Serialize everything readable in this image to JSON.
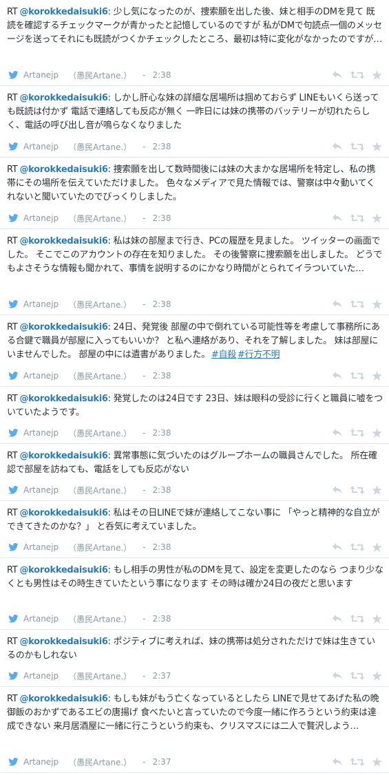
{
  "colors": {
    "link": "#2b7bb9",
    "meta": "#8899a6",
    "text": "#292f33",
    "divider": "#e1e8ed",
    "icon": "#ccd6dd"
  },
  "tweets": [
    {
      "rt": "RT",
      "author": "@korokkedaisuki6",
      "text": ": 少し気になったのが、捜索願を出した後、妹と相手のDMを見て 既読を確認するチェックマークが青かったと記憶しているのですが 私がDMで句読点一個のメッセージを送ってそれにも既読がつくかチェックしたところ、最初は特に変化がなかったのですが…",
      "hashtags": [],
      "via_name": "Artanejp",
      "via_display": "（愚民Artane.）",
      "sep": "-",
      "time": "2:38"
    },
    {
      "rt": "RT",
      "author": "@korokkedaisuki6",
      "text": ": しかし肝心な妹の詳細な居場所は掴めておらず LINEもいくら送っても既読は付かず 電話で連絡しても反応が無く 一昨日には妹の携帯のバッテリーが切れたらしく、電話の呼び出し音が鳴らなくなりました",
      "hashtags": [],
      "via_name": "Artanejp",
      "via_display": "（愚民Artane.）",
      "sep": "-",
      "time": "2:38"
    },
    {
      "rt": "RT",
      "author": "@korokkedaisuki6",
      "text": ": 捜索願を出して数時間後には妹の大まかな居場所を特定し、私の携帯にその場所を伝えていただけました。 色々なメディアで見た情報では、警察は中々動いてくれないと聞いていたのでびっくりしました。",
      "hashtags": [],
      "via_name": "Artanejp",
      "via_display": "（愚民Artane.）",
      "sep": "-",
      "time": "2:38"
    },
    {
      "rt": "RT",
      "author": "@korokkedaisuki6",
      "text": ": 私は妹の部屋まで行き、PCの履歴を見ました。 ツイッターの画面でした。 そこでこのアカウントの存在を知りました。 その後警察に捜索願を出しました。 どうでもよさそうな情報も聞かれて、事情を説明するのにかなり時間がとられてイラついていた…",
      "hashtags": [],
      "via_name": "Artanejp",
      "via_display": "（愚民Artane.）",
      "sep": "-",
      "time": "2:38"
    },
    {
      "rt": "RT",
      "author": "@korokkedaisuki6",
      "text": ": 24日、発覚後 部屋の中で倒れている可能性等を考慮して事務所にある合鍵で職員が部屋に入ってもいいか？ と私へ連絡があり、それを了解しました。 妹は部屋にいませんでした。 部屋の中には遺書がありました。",
      "hashtags": [
        "#自殺",
        "#行方不明"
      ],
      "via_name": "Artanejp",
      "via_display": "（愚民Artane.）",
      "sep": "-",
      "time": "2:38"
    },
    {
      "rt": "RT",
      "author": "@korokkedaisuki6",
      "text": ": 発覚したのは24日です 23日、妹は眼科の受診に行くと職員に嘘をついていたようです。",
      "hashtags": [],
      "via_name": "Artanejp",
      "via_display": "（愚民Artane.）",
      "sep": "-",
      "time": "2:38"
    },
    {
      "rt": "RT",
      "author": "@korokkedaisuki6",
      "text": ": 異常事態に気づいたのはグループホームの職員さんでした。 所在確認で部屋を訪ねても、電話をしても反応がない",
      "hashtags": [],
      "via_name": "Artanejp",
      "via_display": "（愚民Artane.）",
      "sep": "-",
      "time": "2:38"
    },
    {
      "rt": "RT",
      "author": "@korokkedaisuki6",
      "text": ": 私はその日LINEで妹が連絡してこない事に 「やっと精神的な自立ができてきたのかな？」 と呑気に考えていました。",
      "hashtags": [],
      "via_name": "Artanejp",
      "via_display": "（愚民Artane.）",
      "sep": "-",
      "time": "2:38"
    },
    {
      "rt": "RT",
      "author": "@korokkedaisuki6",
      "text": ": もし相手の男性が私のDMを見て、設定を変更したのなら つまり少なくとも男性はその時生きていたという事になります その時は確か24日の夜だと思います",
      "hashtags": [],
      "via_name": "Artanejp",
      "via_display": "（愚民Artane.）",
      "sep": "-",
      "time": "2:38"
    },
    {
      "rt": "RT",
      "author": "@korokkedaisuki6",
      "text": ": ポジティブに考えれば、妹の携帯は処分されただけで妹は生きているのかもしれない",
      "hashtags": [],
      "via_name": "Artanejp",
      "via_display": "（愚民Artane.）",
      "sep": "-",
      "time": "2:37"
    },
    {
      "rt": "RT",
      "author": "@korokkedaisuki6",
      "text": ": もしも妹がもう亡くなっているとしたら LINEで見せてあげた私の晩御飯のおかずであるエビの唐揚げ 食べたいと言っていたので今度一緒に作ろうという約束は達成できない 来月居酒屋に一緒に行こうという約束も、クリスマスには二人で贅沢しよう…",
      "hashtags": [],
      "via_name": "Artanejp",
      "via_display": "（愚民Artane.）",
      "sep": "-",
      "time": "2:37"
    }
  ]
}
